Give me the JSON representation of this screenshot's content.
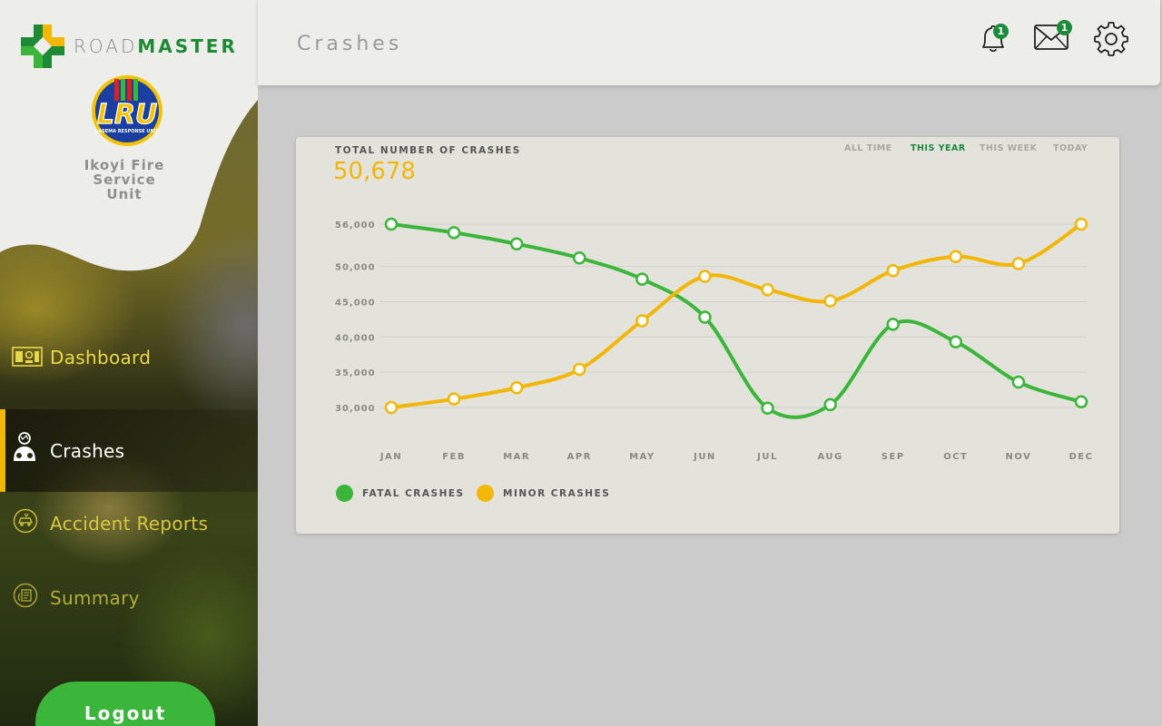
{
  "brand": {
    "road": "ROAD",
    "master": "MASTER"
  },
  "unit": {
    "logo_text": "LRU",
    "logo_subtext": "LASEMA RESPONSE UNIT",
    "name": "Ikoyi Fire Service Unit"
  },
  "nav": [
    {
      "label": "Dashboard",
      "icon": "dashboard-icon"
    },
    {
      "label": "Crashes",
      "icon": "crash-victim-icon"
    },
    {
      "label": "Accident Reports",
      "icon": "car-accident-icon"
    },
    {
      "label": "Summary",
      "icon": "summary-icon"
    }
  ],
  "logout_label": "Logout",
  "header": {
    "title": "Crashes",
    "notifications_count": "1",
    "messages_count": "1"
  },
  "card": {
    "title": "TOTAL NUMBER OF CRASHES",
    "total": "50,678",
    "filters": [
      "ALL TIME",
      "THIS YEAR",
      "THIS WEEK",
      "TODAY"
    ],
    "active_filter": "THIS YEAR"
  },
  "chart_data": {
    "type": "line",
    "title": "",
    "xlabel": "",
    "ylabel": "",
    "categories": [
      "JAN",
      "FEB",
      "MAR",
      "APR",
      "MAY",
      "JUN",
      "JUL",
      "AUG",
      "SEP",
      "OCT",
      "NOV",
      "DEC"
    ],
    "y_ticks": [
      30000,
      35000,
      40000,
      45000,
      50000,
      56000
    ],
    "y_tick_labels": [
      "30,000",
      "35,000",
      "40,000",
      "45,000",
      "50,000",
      "56,000"
    ],
    "series": [
      {
        "name": "FATAL CRASHES",
        "color": "#3bb53a",
        "values": [
          56000,
          54800,
          53200,
          51200,
          48200,
          42800,
          29900,
          30400,
          41800,
          39300,
          33600,
          30800
        ]
      },
      {
        "name": "MINOR CRASHES",
        "color": "#f2b705",
        "values": [
          30000,
          31200,
          32800,
          35400,
          42300,
          48600,
          46700,
          45100,
          49400,
          51400,
          50400,
          56000
        ]
      }
    ],
    "grid": true,
    "legend": "bottom-left"
  },
  "colors": {
    "accent_green": "#1b8a3a",
    "accent_yellow": "#f2b705",
    "button_green": "#3bb53a"
  }
}
